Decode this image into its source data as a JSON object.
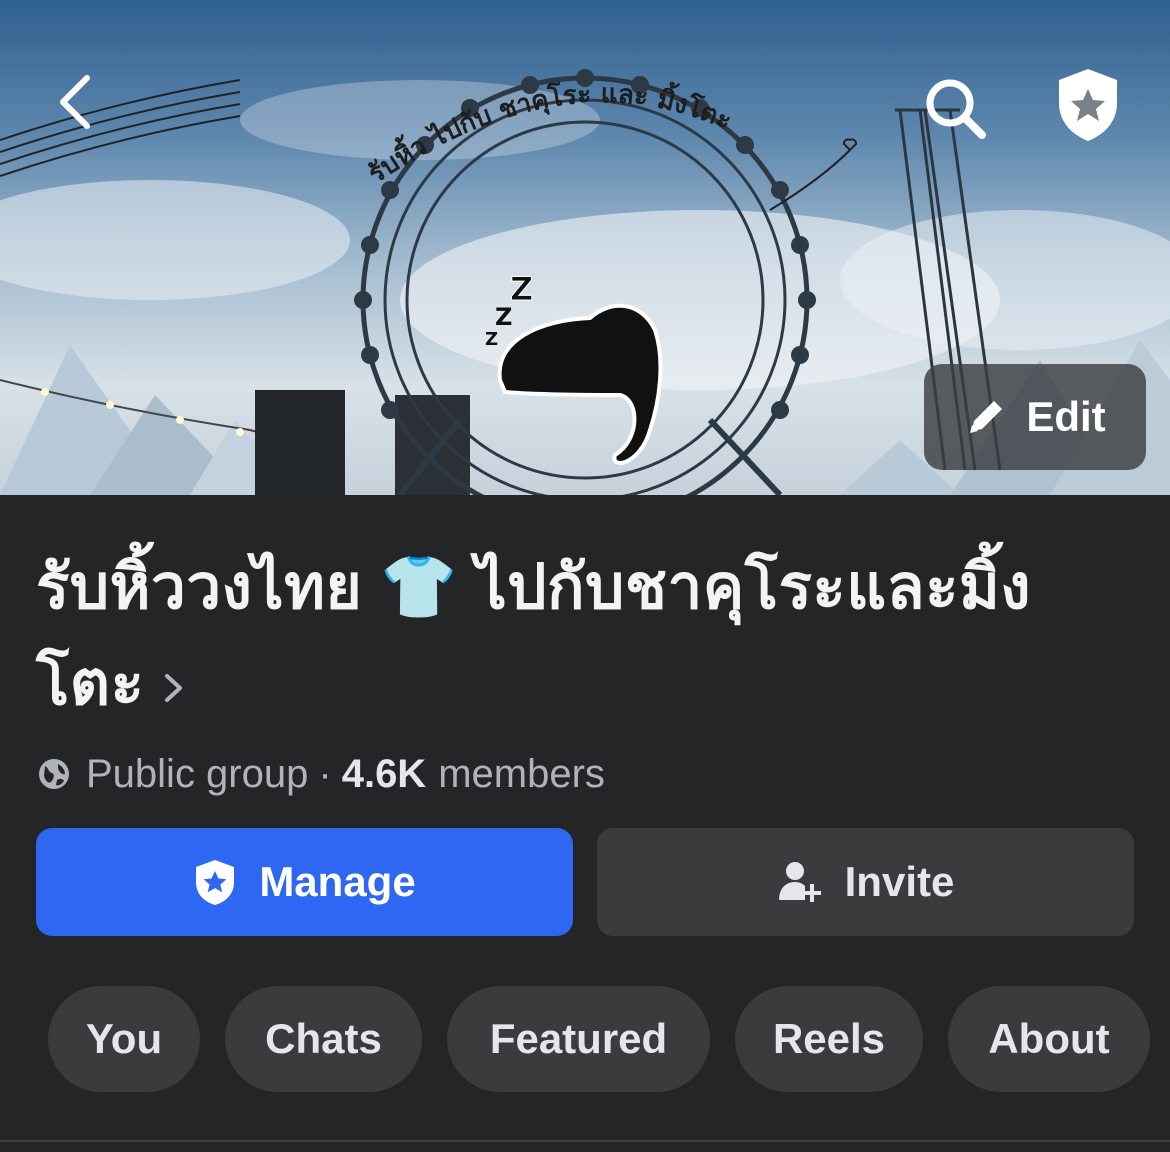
{
  "cover": {
    "artwork_text": "รับหิ้ว ไปกับ ชาคุโระ และ มิ้งโตะ",
    "edit_label": "Edit"
  },
  "header_icons": {
    "back": "chevron-left-icon",
    "search": "search-icon",
    "admin": "admin-shield-icon"
  },
  "group": {
    "title_part1": "รับหิ้ววงไทย",
    "title_emoji": "👕",
    "title_part2": "ไปกับชาคุโระและมิ้งโตะ",
    "privacy": "Public group",
    "separator": "·",
    "member_count": "4.6K",
    "members_label": "members"
  },
  "actions": {
    "manage_label": "Manage",
    "invite_label": "Invite"
  },
  "tabs": [
    {
      "label": "You"
    },
    {
      "label": "Chats"
    },
    {
      "label": "Featured"
    },
    {
      "label": "Reels"
    },
    {
      "label": "About"
    }
  ],
  "colors": {
    "background": "#242526",
    "manage_blue": "#2d67f2",
    "secondary_button": "#3a3b3c"
  }
}
